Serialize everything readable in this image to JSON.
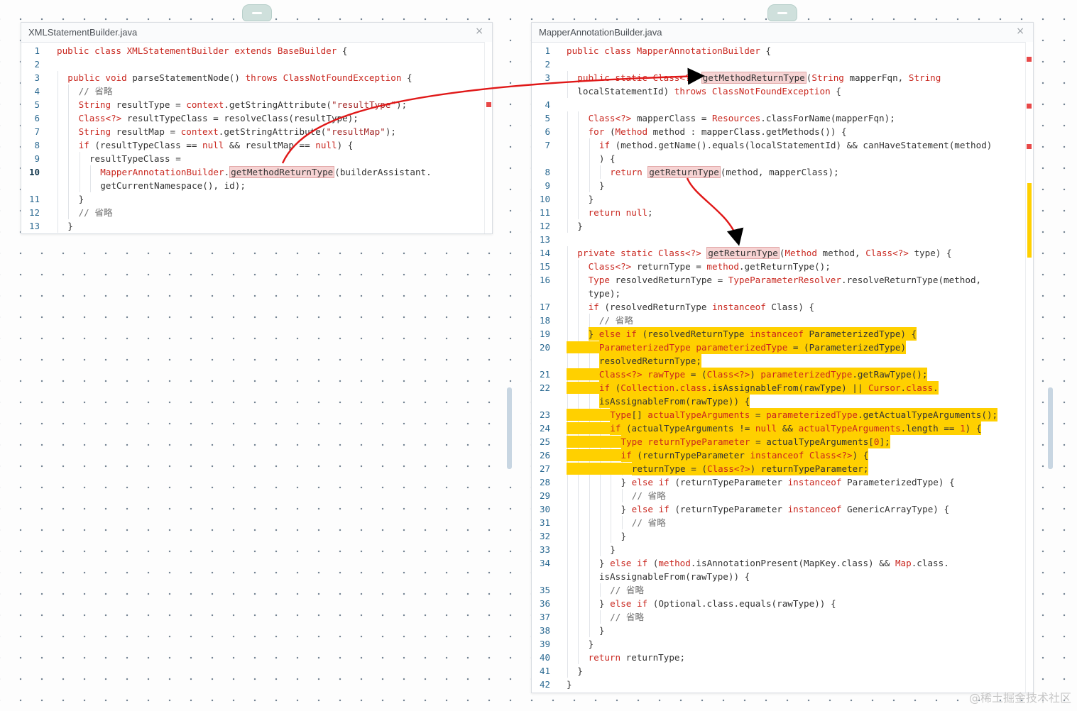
{
  "left_panel": {
    "title": "XMLStatementBuilder.java",
    "close_glyph": "×",
    "lines": [
      {
        "n": "1",
        "segs": [
          [
            "kw",
            "public class "
          ],
          [
            "kw",
            "XMLStatementBuilder"
          ],
          [
            "",
            " "
          ],
          [
            "kw",
            "extends"
          ],
          [
            "",
            " "
          ],
          [
            "kw",
            "BaseBuilder"
          ],
          [
            "",
            " {"
          ]
        ],
        "indent": 0
      },
      {
        "n": "2",
        "segs": [],
        "indent": 0
      },
      {
        "n": "3",
        "segs": [
          [
            "kw",
            "public void "
          ],
          [
            "",
            "parseStatementNode() "
          ],
          [
            "kw",
            "throws "
          ],
          [
            "kw",
            "ClassNotFoundException"
          ],
          [
            "",
            " {"
          ]
        ],
        "indent": 1
      },
      {
        "n": "4",
        "segs": [
          [
            "cm",
            "// 省略"
          ]
        ],
        "indent": 2
      },
      {
        "n": "5",
        "segs": [
          [
            "kw",
            "String "
          ],
          [
            "",
            "resultType = "
          ],
          [
            "kw",
            "context"
          ],
          [
            "",
            ".getStringAttribute("
          ],
          [
            "str",
            "\"resultType\""
          ],
          [
            "",
            ");"
          ]
        ],
        "indent": 2
      },
      {
        "n": "6",
        "segs": [
          [
            "kw",
            "Class<?> "
          ],
          [
            "",
            "resultTypeClass = resolveClass(resultType);"
          ]
        ],
        "indent": 2
      },
      {
        "n": "7",
        "segs": [
          [
            "kw",
            "String "
          ],
          [
            "",
            "resultMap = "
          ],
          [
            "kw",
            "context"
          ],
          [
            "",
            ".getStringAttribute("
          ],
          [
            "str",
            "\"resultMap\""
          ],
          [
            "",
            ");"
          ]
        ],
        "indent": 2
      },
      {
        "n": "8",
        "segs": [
          [
            "kw",
            "if "
          ],
          [
            "",
            "(resultTypeClass == "
          ],
          [
            "kw",
            "null"
          ],
          [
            "",
            " && resultMap == "
          ],
          [
            "kw",
            "null"
          ],
          [
            "",
            ") {"
          ]
        ],
        "indent": 2
      },
      {
        "n": "9",
        "segs": [
          [
            "",
            "resultTypeClass ="
          ]
        ],
        "indent": 3
      },
      {
        "n": "10",
        "cur": true,
        "segs": [
          [
            "kw",
            "MapperAnnotationBuilder"
          ],
          [
            "",
            "."
          ],
          [
            "mhl",
            "getMethodReturnType"
          ],
          [
            "",
            "(builderAssistant."
          ]
        ],
        "indent": 4
      },
      {
        "n": "",
        "segs": [
          [
            "",
            "getCurrentNamespace(), id);"
          ]
        ],
        "indent": 4
      },
      {
        "n": "11",
        "segs": [
          [
            "",
            "}"
          ]
        ],
        "indent": 2
      },
      {
        "n": "12",
        "segs": [
          [
            "cm",
            "// 省略"
          ]
        ],
        "indent": 2
      },
      {
        "n": "13",
        "segs": [
          [
            "",
            "}"
          ]
        ],
        "indent": 1
      }
    ]
  },
  "right_panel": {
    "title": "MapperAnnotationBuilder.java",
    "close_glyph": "×",
    "lines": [
      {
        "n": "1",
        "segs": [
          [
            "kw",
            "public class "
          ],
          [
            "kw",
            "MapperAnnotationBuilder"
          ],
          [
            "",
            " {"
          ]
        ],
        "indent": 0
      },
      {
        "n": "2",
        "segs": [],
        "indent": 0
      },
      {
        "n": "3",
        "segs": [
          [
            "kw",
            "public static "
          ],
          [
            "kw",
            "Class<?> "
          ],
          [
            "mhl",
            "getMethodReturnType"
          ],
          [
            "",
            "("
          ],
          [
            "kw",
            "String "
          ],
          [
            "",
            "mapperFqn, "
          ],
          [
            "kw",
            "String"
          ]
        ],
        "indent": 1
      },
      {
        "n": "",
        "segs": [
          [
            "",
            "localStatementId) "
          ],
          [
            "kw",
            "throws "
          ],
          [
            "kw",
            "ClassNotFoundException"
          ],
          [
            "",
            " {"
          ]
        ],
        "indent": 1
      },
      {
        "n": "4",
        "segs": [],
        "indent": 0
      },
      {
        "n": "5",
        "segs": [
          [
            "kw",
            "Class<?> "
          ],
          [
            "",
            "mapperClass = "
          ],
          [
            "kw",
            "Resources"
          ],
          [
            "",
            ".classForName(mapperFqn);"
          ]
        ],
        "indent": 2
      },
      {
        "n": "6",
        "segs": [
          [
            "kw",
            "for "
          ],
          [
            "",
            "("
          ],
          [
            "kw",
            "Method "
          ],
          [
            "",
            "method : mapperClass.getMethods()) {"
          ]
        ],
        "indent": 2
      },
      {
        "n": "7",
        "segs": [
          [
            "kw",
            "if "
          ],
          [
            "",
            "(method.getName().equals(localStatementId) && canHaveStatement(method)"
          ]
        ],
        "indent": 3
      },
      {
        "n": "",
        "segs": [
          [
            "",
            ") {"
          ]
        ],
        "indent": 3
      },
      {
        "n": "8",
        "segs": [
          [
            "kw",
            "return "
          ],
          [
            "mhl",
            "getReturnType"
          ],
          [
            "",
            "(method, mapperClass);"
          ]
        ],
        "indent": 4
      },
      {
        "n": "9",
        "segs": [
          [
            "",
            "}"
          ]
        ],
        "indent": 3
      },
      {
        "n": "10",
        "segs": [
          [
            "",
            "}"
          ]
        ],
        "indent": 2
      },
      {
        "n": "11",
        "segs": [
          [
            "kw",
            "return null"
          ],
          [
            "",
            ";"
          ]
        ],
        "indent": 2
      },
      {
        "n": "12",
        "segs": [
          [
            "",
            "}"
          ]
        ],
        "indent": 1
      },
      {
        "n": "13",
        "segs": [],
        "indent": 0
      },
      {
        "n": "14",
        "segs": [
          [
            "kw",
            "private static "
          ],
          [
            "kw",
            "Class<?> "
          ],
          [
            "mhl",
            "getReturnType"
          ],
          [
            "",
            "("
          ],
          [
            "kw",
            "Method "
          ],
          [
            "",
            "method, "
          ],
          [
            "kw",
            "Class<?> "
          ],
          [
            "",
            "type) {"
          ]
        ],
        "indent": 1
      },
      {
        "n": "15",
        "segs": [
          [
            "kw",
            "Class<?> "
          ],
          [
            "",
            "returnType = "
          ],
          [
            "kw",
            "method"
          ],
          [
            "",
            ".getReturnType();"
          ]
        ],
        "indent": 2
      },
      {
        "n": "16",
        "segs": [
          [
            "kw",
            "Type "
          ],
          [
            "",
            "resolvedReturnType = "
          ],
          [
            "kw",
            "TypeParameterResolver"
          ],
          [
            "",
            ".resolveReturnType(method,"
          ]
        ],
        "indent": 2
      },
      {
        "n": "",
        "segs": [
          [
            "",
            "type);"
          ]
        ],
        "indent": 2
      },
      {
        "n": "17",
        "segs": [
          [
            "kw",
            "if "
          ],
          [
            "",
            "(resolvedReturnType "
          ],
          [
            "kw",
            "instanceof "
          ],
          [
            "",
            "Class) {"
          ]
        ],
        "indent": 2
      },
      {
        "n": "18",
        "segs": [
          [
            "cm",
            "// 省略"
          ]
        ],
        "indent": 3
      },
      {
        "n": "19",
        "hl": "partial",
        "segs": [
          [
            "",
            "} "
          ],
          [
            "kw",
            "else if "
          ],
          [
            "",
            "(resolvedReturnType "
          ],
          [
            "kw",
            "instanceof "
          ],
          [
            "",
            "ParameterizedType) {"
          ]
        ],
        "indent": 2
      },
      {
        "n": "20",
        "hl": "full",
        "segs": [
          [
            "kw",
            "ParameterizedType "
          ],
          [
            "kw",
            "parameterizedType"
          ],
          [
            "",
            " = (ParameterizedType)"
          ]
        ],
        "indent": 3
      },
      {
        "n": "",
        "hl": "partial",
        "segs": [
          [
            "",
            "resolvedReturnType;"
          ]
        ],
        "indent": 3
      },
      {
        "n": "21",
        "hl": "full",
        "segs": [
          [
            "kw",
            "Class<?> "
          ],
          [
            "kw",
            "rawType"
          ],
          [
            "",
            " = ("
          ],
          [
            "kw",
            "Class<?>"
          ],
          [
            "",
            ") "
          ],
          [
            "kw",
            "parameterizedType"
          ],
          [
            "",
            ".getRawType();"
          ]
        ],
        "indent": 3
      },
      {
        "n": "22",
        "hl": "full",
        "segs": [
          [
            "kw",
            "if "
          ],
          [
            "",
            "("
          ],
          [
            "kw",
            "Collection"
          ],
          [
            "",
            "."
          ],
          [
            "kw",
            "class"
          ],
          [
            "",
            ".isAssignableFrom(rawType) || "
          ],
          [
            "kw",
            "Cursor"
          ],
          [
            "",
            "."
          ],
          [
            "kw",
            "class"
          ],
          [
            "",
            "."
          ]
        ],
        "indent": 3
      },
      {
        "n": "",
        "hl": "partial",
        "segs": [
          [
            "",
            "isAssignableFrom(rawType)) {"
          ]
        ],
        "indent": 3
      },
      {
        "n": "23",
        "hl": "full",
        "segs": [
          [
            "kw",
            "Type"
          ],
          [
            "",
            "[] "
          ],
          [
            "kw",
            "actualTypeArguments"
          ],
          [
            "",
            " = "
          ],
          [
            "kw",
            "parameterizedType"
          ],
          [
            "",
            ".getActualTypeArguments();"
          ]
        ],
        "indent": 4
      },
      {
        "n": "24",
        "hl": "full",
        "segs": [
          [
            "kw",
            "if "
          ],
          [
            "",
            "(actualTypeArguments != "
          ],
          [
            "kw",
            "null"
          ],
          [
            "",
            " && "
          ],
          [
            "kw",
            "actualTypeArguments"
          ],
          [
            "",
            ".length == "
          ],
          [
            "kw",
            "1"
          ],
          [
            "",
            ") {"
          ]
        ],
        "indent": 4
      },
      {
        "n": "25",
        "hl": "full",
        "segs": [
          [
            "kw",
            "Type "
          ],
          [
            "kw",
            "returnTypeParameter"
          ],
          [
            "",
            " = actualTypeArguments["
          ],
          [
            "kw",
            "0"
          ],
          [
            "",
            "];"
          ]
        ],
        "indent": 5
      },
      {
        "n": "26",
        "hl": "full",
        "segs": [
          [
            "kw",
            "if "
          ],
          [
            "",
            "(returnTypeParameter "
          ],
          [
            "kw",
            "instanceof "
          ],
          [
            "kw",
            "Class<?>"
          ],
          [
            "",
            ") {"
          ]
        ],
        "indent": 5
      },
      {
        "n": "27",
        "hl": "full",
        "segs": [
          [
            "",
            "returnType = ("
          ],
          [
            "kw",
            "Class<?>"
          ],
          [
            "",
            ") returnTypeParameter;"
          ]
        ],
        "indent": 6
      },
      {
        "n": "28",
        "segs": [
          [
            "",
            "} "
          ],
          [
            "kw",
            "else if "
          ],
          [
            "",
            "(returnTypeParameter "
          ],
          [
            "kw",
            "instanceof "
          ],
          [
            "",
            "ParameterizedType) {"
          ]
        ],
        "indent": 5
      },
      {
        "n": "29",
        "segs": [
          [
            "cm",
            "// 省略"
          ]
        ],
        "indent": 6
      },
      {
        "n": "30",
        "segs": [
          [
            "",
            "} "
          ],
          [
            "kw",
            "else if "
          ],
          [
            "",
            "(returnTypeParameter "
          ],
          [
            "kw",
            "instanceof "
          ],
          [
            "",
            "GenericArrayType) {"
          ]
        ],
        "indent": 5
      },
      {
        "n": "31",
        "segs": [
          [
            "cm",
            "// 省略"
          ]
        ],
        "indent": 6
      },
      {
        "n": "32",
        "segs": [
          [
            "",
            "}"
          ]
        ],
        "indent": 5
      },
      {
        "n": "33",
        "segs": [
          [
            "",
            "}"
          ]
        ],
        "indent": 4
      },
      {
        "n": "34",
        "segs": [
          [
            "",
            "} "
          ],
          [
            "kw",
            "else if "
          ],
          [
            "",
            "("
          ],
          [
            "kw",
            "method"
          ],
          [
            "",
            ".isAnnotationPresent(MapKey.class) && "
          ],
          [
            "kw",
            "Map"
          ],
          [
            "",
            ".class."
          ]
        ],
        "indent": 3
      },
      {
        "n": "",
        "segs": [
          [
            "",
            "isAssignableFrom(rawType)) {"
          ]
        ],
        "indent": 3
      },
      {
        "n": "35",
        "segs": [
          [
            "cm",
            "// 省略"
          ]
        ],
        "indent": 4
      },
      {
        "n": "36",
        "segs": [
          [
            "",
            "} "
          ],
          [
            "kw",
            "else if "
          ],
          [
            "",
            "(Optional.class.equals(rawType)) {"
          ]
        ],
        "indent": 3
      },
      {
        "n": "37",
        "segs": [
          [
            "cm",
            "// 省略"
          ]
        ],
        "indent": 4
      },
      {
        "n": "38",
        "segs": [
          [
            "",
            "}"
          ]
        ],
        "indent": 3
      },
      {
        "n": "39",
        "segs": [
          [
            "",
            "}"
          ]
        ],
        "indent": 2
      },
      {
        "n": "40",
        "segs": [
          [
            "kw",
            "return "
          ],
          [
            "",
            "returnType;"
          ]
        ],
        "indent": 2
      },
      {
        "n": "41",
        "segs": [
          [
            "",
            "}"
          ]
        ],
        "indent": 1
      },
      {
        "n": "42",
        "segs": [
          [
            "",
            "}"
          ]
        ],
        "indent": 0
      }
    ]
  },
  "watermark": "@稀土掘金技术社区",
  "colors": {
    "keyword": "#c9271f",
    "highlight": "#ffd000",
    "arrow": "#e01818",
    "method_highlight": "#f6d3d3"
  }
}
